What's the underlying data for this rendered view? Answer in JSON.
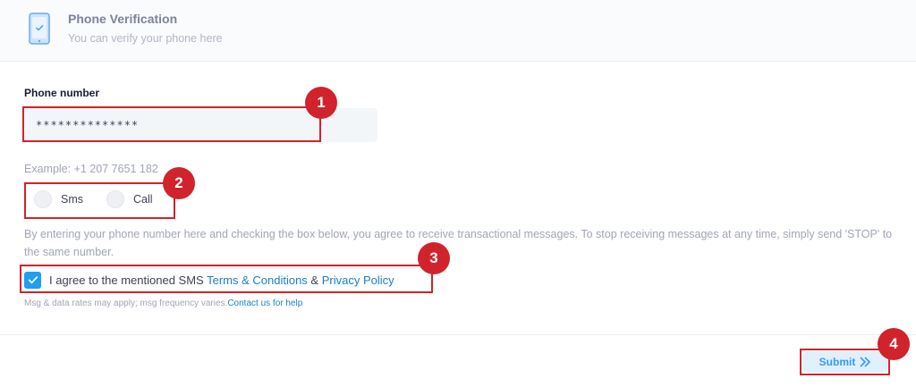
{
  "header": {
    "title": "Phone Verification",
    "subtitle": "You can verify your phone here",
    "icon": "phone-check-icon"
  },
  "form": {
    "phone_label": "Phone number",
    "phone_value": "**************",
    "example": "Example: +1 207 7651 182",
    "radio_options": [
      "Sms",
      "Call"
    ],
    "consent_text": "By entering your phone number here and checking the box below, you agree to receive transactional messages. To stop receiving messages at any time, simply send 'STOP' to the same number.",
    "agree": {
      "checked": true,
      "prefix": "I agree to the mentioned SMS ",
      "terms_link": "Terms & Conditions",
      "joiner": " & ",
      "privacy_link": "Privacy Policy"
    },
    "rates_text": "Msg & data rates may apply; msg frequency varies.",
    "contact_link": "Contact us for help",
    "submit_label": "Submit"
  },
  "callouts": [
    "1",
    "2",
    "3",
    "4"
  ],
  "colors": {
    "accent": "#3699ff",
    "link": "#1a7fc8",
    "checkbox": "#1e9ff2",
    "callout": "#d0232b"
  }
}
